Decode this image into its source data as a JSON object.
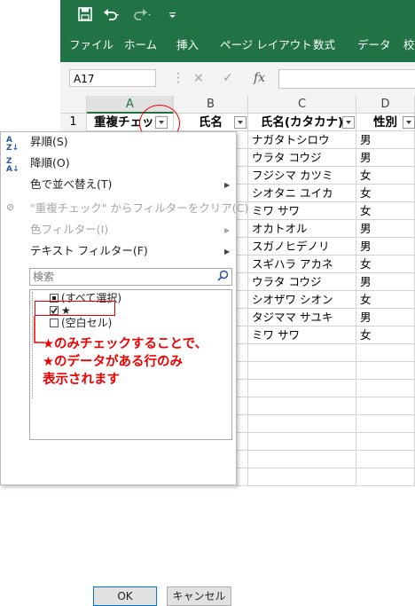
{
  "quick_access": {
    "save_icon": "save-icon",
    "undo_icon": "undo-icon",
    "redo_icon": "redo-icon",
    "customize_icon": "customize-icon"
  },
  "ribbon": {
    "color": "#217346",
    "tabs": [
      "ファイル",
      "ホーム",
      "挿入",
      "ページ レイアウト",
      "数式",
      "データ",
      "校"
    ]
  },
  "formula_bar": {
    "name_box": "A17",
    "cancel_icon": "×",
    "enter_icon": "✓",
    "fx_label": "fx"
  },
  "columns": [
    "A",
    "B",
    "C",
    "D"
  ],
  "row_header": "1",
  "header_row": [
    "重複チェック",
    "氏名",
    "氏名(カタカナ)",
    "性別"
  ],
  "rows": [
    {
      "kana": "ナガタトシロウ",
      "sex": "男"
    },
    {
      "kana": "ウラタ コウジ",
      "sex": "男"
    },
    {
      "kana": "フジシマ カツミ",
      "sex": "女"
    },
    {
      "kana": "シオタニ ユイカ",
      "sex": "女"
    },
    {
      "kana": "ミワ サワ",
      "sex": "女"
    },
    {
      "kana": "オカトオル",
      "sex": "男"
    },
    {
      "kana": "スガノヒデノリ",
      "sex": "男"
    },
    {
      "kana": "スギハラ アカネ",
      "sex": "女"
    },
    {
      "kana": "ウラタ コウジ",
      "sex": "男"
    },
    {
      "kana": "シオザワ シオン",
      "sex": "女"
    },
    {
      "kana": "タジママ サユキ",
      "sex": "男"
    },
    {
      "kana": "ミワ サワ",
      "sex": "女"
    }
  ],
  "filter_menu": {
    "sort_asc": "昇順(S)",
    "sort_desc": "降順(O)",
    "sort_by_color": "色で並べ替え(T)",
    "clear_filter": "\"重複チェック\" からフィルターをクリア(C)",
    "color_filter": "色フィルター(I)",
    "text_filter": "テキスト フィルター(F)",
    "search_placeholder": "検索",
    "items": [
      {
        "label": "(すべて選択)",
        "state": "partial"
      },
      {
        "label": "★",
        "state": "checked"
      },
      {
        "label": "(空白セル)",
        "state": "unchecked"
      }
    ],
    "ok": "OK",
    "cancel": "キャンセル"
  },
  "annotation": {
    "line1": "★のみチェックすることで、",
    "line2": "★のデータがある行のみ",
    "line3": "表示されます",
    "color": "#e00000"
  }
}
